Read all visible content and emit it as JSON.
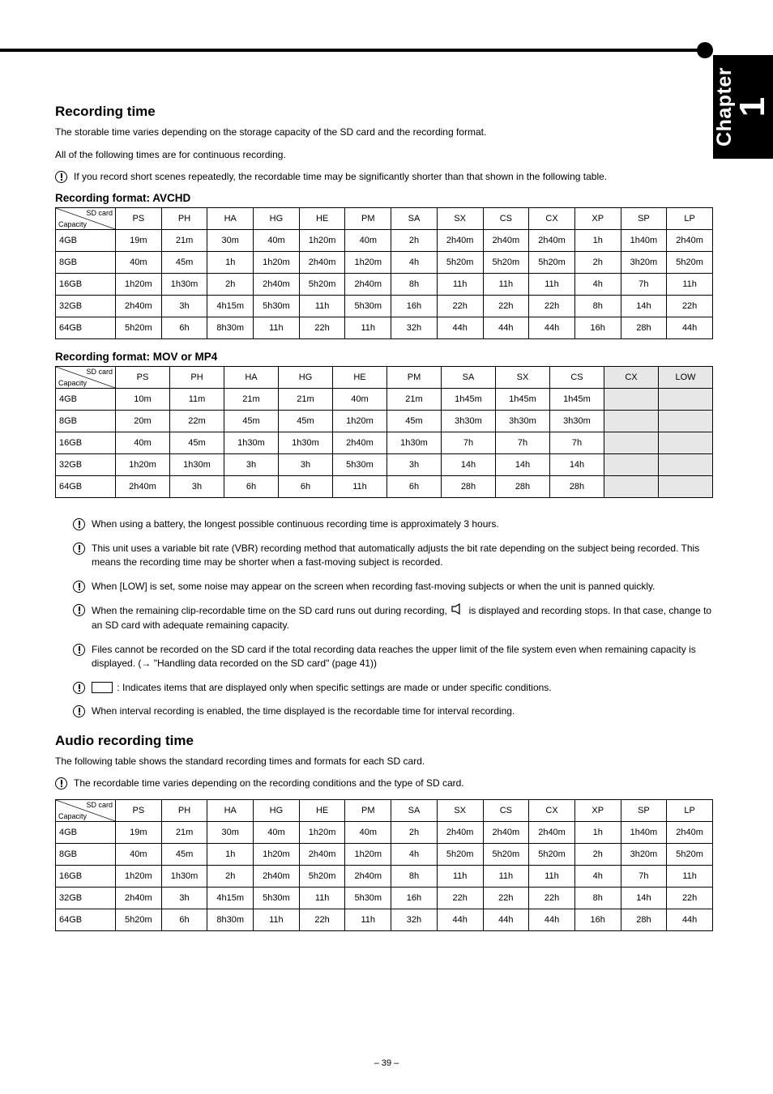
{
  "side_tab": {
    "chapter_word": "Chapter",
    "chapter_no": "1"
  },
  "section": {
    "title": "Recording time",
    "intro1": "The storable time varies depending on the storage capacity of the SD card and the recording format.",
    "intro2": "All of the following times are for continuous recording.",
    "note_intro": "If you record short scenes repeatedly, the recordable time may be significantly shorter than that shown in the following table."
  },
  "tables": {
    "header_label": "SD card",
    "row_word": "Capacity",
    "t1_caption": "Recording format: AVCHD",
    "t1_cols": [
      "PS",
      "PH",
      "HA",
      "HG",
      "HE",
      "PM",
      "SA",
      "SX",
      "CS",
      "CX",
      "XP",
      "SP",
      "LP"
    ],
    "t1_rows": [
      {
        "label": "4GB",
        "cells": [
          "19m",
          "21m",
          "30m",
          "40m",
          "1h20m",
          "40m",
          "2h",
          "2h40m",
          "2h40m",
          "2h40m",
          "1h",
          "1h40m",
          "2h40m"
        ]
      },
      {
        "label": "8GB",
        "cells": [
          "40m",
          "45m",
          "1h",
          "1h20m",
          "2h40m",
          "1h20m",
          "4h",
          "5h20m",
          "5h20m",
          "5h20m",
          "2h",
          "3h20m",
          "5h20m"
        ]
      },
      {
        "label": "16GB",
        "cells": [
          "1h20m",
          "1h30m",
          "2h",
          "2h40m",
          "5h20m",
          "2h40m",
          "8h",
          "11h",
          "11h",
          "11h",
          "4h",
          "7h",
          "11h"
        ]
      },
      {
        "label": "32GB",
        "cells": [
          "2h40m",
          "3h",
          "4h15m",
          "5h30m",
          "11h",
          "5h30m",
          "16h",
          "22h",
          "22h",
          "22h",
          "8h",
          "14h",
          "22h"
        ]
      },
      {
        "label": "64GB",
        "cells": [
          "5h20m",
          "6h",
          "8h30m",
          "11h",
          "22h",
          "11h",
          "32h",
          "44h",
          "44h",
          "44h",
          "16h",
          "28h",
          "44h"
        ]
      }
    ],
    "t2_caption": "Recording format: MOV or MP4",
    "t2_cols": [
      "PS",
      "PH",
      "HA",
      "HG",
      "HE",
      "PM",
      "SA",
      "SX",
      "CS",
      "CX",
      "LOW"
    ],
    "t2_rows": [
      {
        "label": "4GB",
        "cells": [
          "10m",
          "11m",
          "21m",
          "21m",
          "40m",
          "21m",
          "1h45m",
          "1h45m",
          "1h45m",
          "",
          ""
        ]
      },
      {
        "label": "8GB",
        "cells": [
          "20m",
          "22m",
          "45m",
          "45m",
          "1h20m",
          "45m",
          "3h30m",
          "3h30m",
          "3h30m",
          "",
          ""
        ]
      },
      {
        "label": "16GB",
        "cells": [
          "40m",
          "45m",
          "1h30m",
          "1h30m",
          "2h40m",
          "1h30m",
          "7h",
          "7h",
          "7h",
          "",
          ""
        ]
      },
      {
        "label": "32GB",
        "cells": [
          "1h20m",
          "1h30m",
          "3h",
          "3h",
          "5h30m",
          "3h",
          "14h",
          "14h",
          "14h",
          "",
          ""
        ]
      },
      {
        "label": "64GB",
        "cells": [
          "2h40m",
          "3h",
          "6h",
          "6h",
          "11h",
          "6h",
          "28h",
          "28h",
          "28h",
          "",
          ""
        ]
      }
    ],
    "t2_shaded_cols": [
      9,
      10
    ]
  },
  "notes": {
    "n1": "When using a battery, the longest possible continuous recording time is approximately 3 hours.",
    "n2": "This unit uses a variable bit rate (VBR) recording method that automatically adjusts the bit rate depending on the subject being recorded. This means the recording time may be shorter when a fast-moving subject is recorded.",
    "n3": "When [LOW] is set, some noise may appear on the screen when recording fast-moving subjects or when the unit is panned quickly.",
    "n4_pre": "When the remaining clip-recordable time on the SD card runs out during recording, ",
    "n4_icon": "speaker",
    "n4_post": " is displayed and recording stops. In that case, change to an SD card with adequate remaining capacity.",
    "n5": "Files cannot be recorded on the SD card if the total recording data reaches the upper limit of the file system even when remaining capacity is displayed. (→ \"Handling data recorded on the SD card\" (page 41))",
    "n6_pre": "",
    "n6_rect": true,
    "n6_text": " : Indicates items that are displayed only when specific settings are made or under specific conditions.",
    "n7": "When interval recording is enabled, the time displayed is the recordable time for interval recording."
  },
  "audio": {
    "title": "Audio recording time",
    "intro": "The following table shows the standard recording times and formats for each SD card.",
    "note": "The recordable time varies depending on the recording conditions and the type of SD card."
  },
  "table3": {
    "cols": [
      "PS",
      "PH",
      "HA",
      "HG",
      "HE",
      "PM",
      "SA",
      "SX",
      "CS",
      "CX",
      "XP",
      "SP",
      "LP"
    ],
    "rows": [
      {
        "label": "4GB",
        "cells": [
          "19m",
          "21m",
          "30m",
          "40m",
          "1h20m",
          "40m",
          "2h",
          "2h40m",
          "2h40m",
          "2h40m",
          "1h",
          "1h40m",
          "2h40m"
        ]
      },
      {
        "label": "8GB",
        "cells": [
          "40m",
          "45m",
          "1h",
          "1h20m",
          "2h40m",
          "1h20m",
          "4h",
          "5h20m",
          "5h20m",
          "5h20m",
          "2h",
          "3h20m",
          "5h20m"
        ]
      },
      {
        "label": "16GB",
        "cells": [
          "1h20m",
          "1h30m",
          "2h",
          "2h40m",
          "5h20m",
          "2h40m",
          "8h",
          "11h",
          "11h",
          "11h",
          "4h",
          "7h",
          "11h"
        ]
      },
      {
        "label": "32GB",
        "cells": [
          "2h40m",
          "3h",
          "4h15m",
          "5h30m",
          "11h",
          "5h30m",
          "16h",
          "22h",
          "22h",
          "22h",
          "8h",
          "14h",
          "22h"
        ]
      },
      {
        "label": "64GB",
        "cells": [
          "5h20m",
          "6h",
          "8h30m",
          "11h",
          "22h",
          "11h",
          "32h",
          "44h",
          "44h",
          "44h",
          "16h",
          "28h",
          "44h"
        ]
      }
    ]
  },
  "page_number": "– 39 –"
}
